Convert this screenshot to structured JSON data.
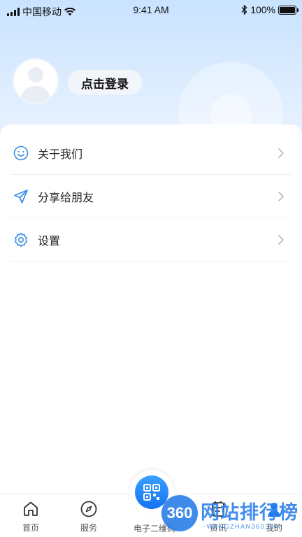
{
  "status_bar": {
    "carrier": "中国移动",
    "time": "9:41 AM",
    "battery": "100%",
    "battery_level": 1.0
  },
  "profile": {
    "login_label": "点击登录",
    "avatar_icon": "default-user-avatar-icon"
  },
  "menu": {
    "items": [
      {
        "label": "关于我们",
        "icon": "smiley-icon"
      },
      {
        "label": "分享给朋友",
        "icon": "send-icon"
      },
      {
        "label": "设置",
        "icon": "gear-icon"
      }
    ],
    "chevron_icon": "chevron-right-icon"
  },
  "tabbar": {
    "tabs": [
      {
        "label": "首页",
        "icon": "home-icon"
      },
      {
        "label": "服务",
        "icon": "compass-icon"
      },
      {
        "label": "电子二维码",
        "icon": "qr-code-icon"
      },
      {
        "label": "资讯",
        "icon": "news-icon"
      },
      {
        "label": "我的",
        "icon": "user-icon"
      }
    ]
  },
  "watermark": {
    "badge": "360",
    "title": "网站排行榜",
    "subtitle": "-WANGZHAN360.CN-"
  },
  "colors": {
    "accent": "#1573f0",
    "icon_blue": "#3a8ee6",
    "hero_top": "#c9e3ff"
  }
}
